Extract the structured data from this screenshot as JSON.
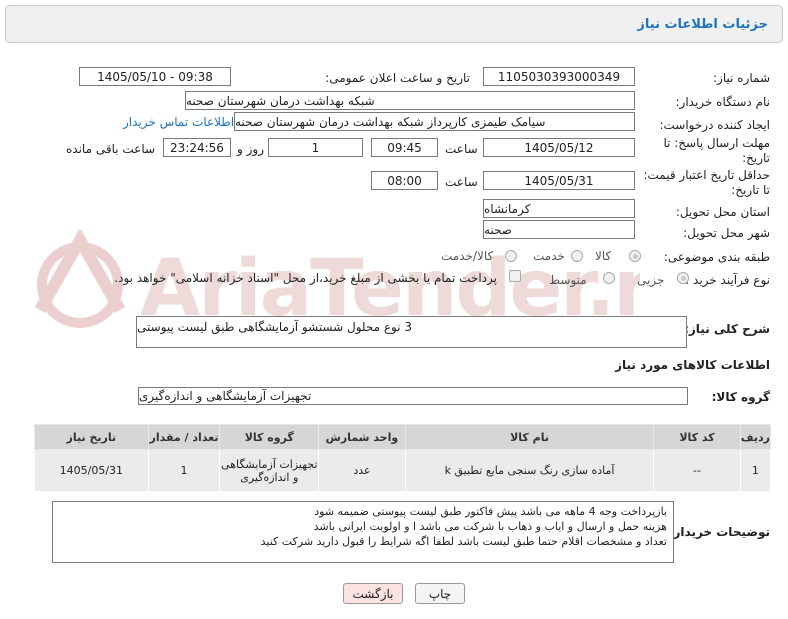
{
  "header": {
    "title": "جزئیات اطلاعات نیاز"
  },
  "fields": {
    "need_number_label": "شماره نیاز:",
    "need_number": "1105030393000349",
    "announce_label": "تاریخ و ساعت اعلان عمومی:",
    "announce_value": "1405/05/10 - 09:38",
    "buyer_org_label": "نام دستگاه خریدار:",
    "buyer_org": "شبکه بهداشت درمان شهرستان صحنه",
    "requester_label": "ایجاد کننده درخواست:",
    "requester": "سیامک طیمزی کارپرداز شبکه بهداشت درمان شهرستان صحنه",
    "buyer_contact_link": "اطلاعات تماس خریدار",
    "reply_deadline_label": "مهلت ارسال پاسخ: تا تاریخ:",
    "reply_date": "1405/05/12",
    "time_label": "ساعت",
    "reply_time": "09:45",
    "days_count": "1",
    "days_label": "روز و",
    "remaining_time": "23:24:56",
    "remaining_label": "ساعت باقی مانده",
    "price_validity_label": "حداقل تاریخ اعتبار قیمت: تا تاریخ:",
    "price_date": "1405/05/31",
    "price_time": "08:00",
    "province_label": "استان محل تحویل:",
    "province": "کرمانشاه",
    "city_label": "شهر محل تحویل:",
    "city": "صحنه",
    "category_label": "طبقه بندی موضوعی:",
    "category_options": [
      "کالا",
      "خدمت",
      "کالا/خدمت"
    ],
    "category_selected": "کالا",
    "process_label": "نوع فرآیند خرید :",
    "process_options": [
      "جزیی",
      "متوسط"
    ],
    "process_selected": "جزیی",
    "payment_note": "پرداخت تمام یا بخشی از مبلغ خرید،از محل \"اسناد خزانه اسلامی\" خواهد بود."
  },
  "summary": {
    "label": "شرح کلی نیاز:",
    "text": "3 نوع محلول شستشو آزمایشگاهی طبق لیست پیوستی"
  },
  "goods_info_title": "اطلاعات کالاهای مورد نیاز",
  "goods_group": {
    "label": "گروه کالا:",
    "value": "تجهیزات آزمایشگاهی و اندازه‌گیری"
  },
  "table": {
    "headers": [
      "ردیف",
      "کد کالا",
      "نام کالا",
      "واحد شمارش",
      "گروه کالا",
      "تعداد / مقدار",
      "تاریخ نیاز"
    ],
    "rows": [
      [
        "1",
        "--",
        "آماده سازی رنگ سنجی مایع تطبیق k",
        "عدد",
        "تجهیزات آزمایشگاهی و اندازه‌گیری",
        "1",
        "1405/05/31"
      ]
    ]
  },
  "buyer_notes": {
    "label": "توضیحات خریدار:",
    "lines": [
      "بازپرداخت وجه 4 ماهه می باشد پیش فاکتور طبق لیست پیوستی ضمیمه شود",
      "هزینه حمل و ارسال و ایاب و ذهاب با شرکت می باشد ا و اولویت ایرانی باشد",
      "تعداد و مشخصات اقلام حتما طبق لیست باشد  لطفا اگه شرایط را قبول دارید شرکت کنید"
    ]
  },
  "buttons": {
    "print": "چاپ",
    "back": "بازگشت"
  },
  "watermark": "AriaTender.neT",
  "colors": {
    "link": "#1e73be",
    "watermark": "#e8c9c9",
    "back_button": "#fbe3e3"
  }
}
